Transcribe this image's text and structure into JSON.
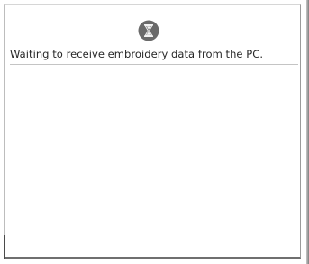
{
  "dialog": {
    "icon": "hourglass-icon",
    "message": "Waiting to receive embroidery data from the PC."
  },
  "colors": {
    "icon_background": "#6a6a6a",
    "icon_glyph": "#f2f2f2",
    "text": "#262626"
  }
}
